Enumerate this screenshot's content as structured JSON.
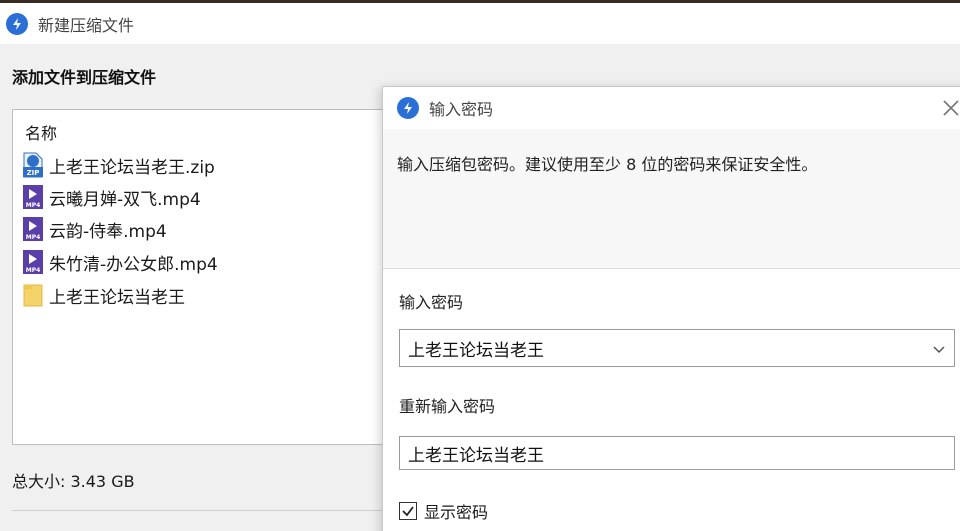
{
  "main_window": {
    "title": "新建压缩文件",
    "section_heading": "添加文件到压缩文件",
    "list_header": "名称",
    "files": [
      {
        "name": "上老王论坛当老王.zip",
        "icon": "zip-file-icon"
      },
      {
        "name": "云曦月婵-双飞.mp4",
        "icon": "mp4-file-icon"
      },
      {
        "name": "云韵-侍奉.mp4",
        "icon": "mp4-file-icon"
      },
      {
        "name": "朱竹清-办公女郎.mp4",
        "icon": "mp4-file-icon"
      },
      {
        "name": "上老王论坛当老王",
        "icon": "folder-icon"
      }
    ],
    "total_size": "总大小: 3.43 GB"
  },
  "dialog": {
    "title": "输入密码",
    "instruction": "输入压缩包密码。建议使用至少 8 位的密码来保证安全性。",
    "password_label": "输入密码",
    "password_value": "上老王论坛当老王",
    "confirm_label": "重新输入密码",
    "confirm_value": "上老王论坛当老王",
    "show_password_label": "显示密码",
    "show_password_checked": true
  },
  "colors": {
    "accent": "#2b6fd6",
    "mp4_icon": "#5b3fa8",
    "folder": "#f5d36b",
    "zip_icon": "#2f6fc7"
  }
}
